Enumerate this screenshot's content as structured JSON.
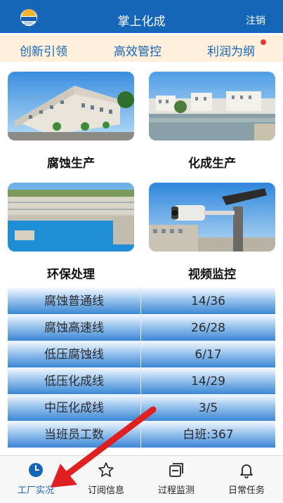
{
  "header": {
    "title": "掌上化成",
    "logout_label": "注销",
    "logo_icon": "zhhc-logo-icon"
  },
  "tagline": {
    "items": [
      "创新引领",
      "高效管控",
      "利润为纲"
    ]
  },
  "tiles": [
    {
      "label": "腐蚀生产",
      "image": "factory-building-photo"
    },
    {
      "label": "化成生产",
      "image": "riverside-plant-photo"
    },
    {
      "label": "环保处理",
      "image": "water-treatment-photo"
    },
    {
      "label": "视频监控",
      "image": "security-camera-photo"
    }
  ],
  "stats": {
    "rows": [
      {
        "name": "腐蚀普通线",
        "value": "14/36"
      },
      {
        "name": "腐蚀高速线",
        "value": "26/28"
      },
      {
        "name": "低压腐蚀线",
        "value": "6/17"
      },
      {
        "name": "低压化成线",
        "value": "14/29"
      },
      {
        "name": "中压化成线",
        "value": "3/5"
      },
      {
        "name": "当班员工数",
        "value": "白班:367"
      }
    ]
  },
  "bottom_nav": {
    "items": [
      {
        "label": "工厂实况",
        "icon": "clock-icon",
        "active": true
      },
      {
        "label": "订阅信息",
        "icon": "star-icon",
        "active": false
      },
      {
        "label": "过程监测",
        "icon": "window-icon",
        "active": false
      },
      {
        "label": "日常任务",
        "icon": "bell-icon",
        "active": false
      }
    ]
  },
  "colors": {
    "primary": "#1566b8",
    "tagline_bg": "#fff0dc",
    "notification": "#e83c32",
    "annotation_arrow": "#e02020"
  }
}
